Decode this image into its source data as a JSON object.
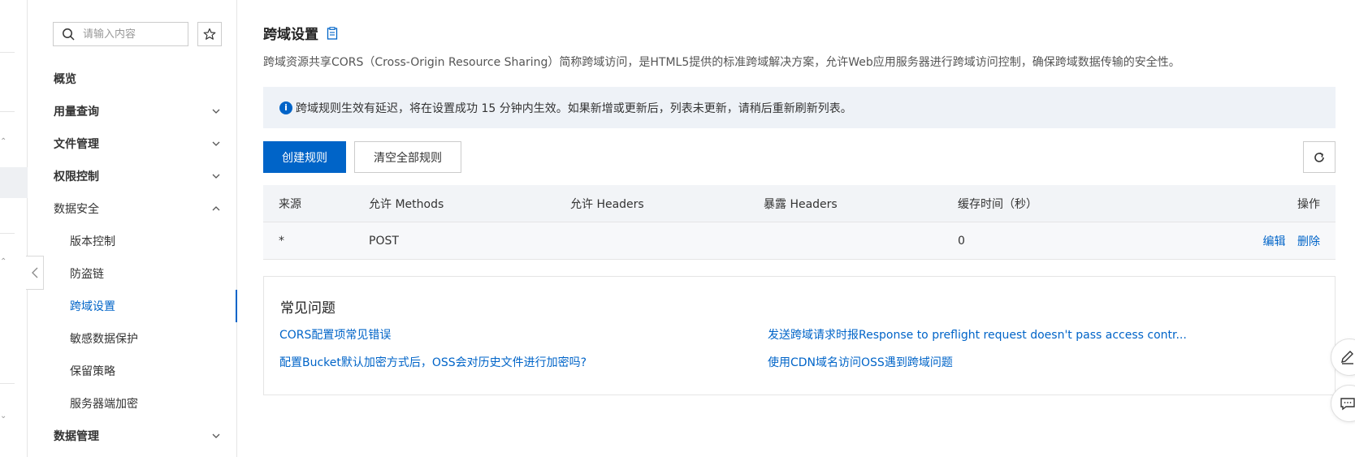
{
  "sidebar": {
    "search_placeholder": "请输入内容",
    "nav": [
      {
        "label": "概览"
      },
      {
        "label": "用量查询"
      },
      {
        "label": "文件管理"
      },
      {
        "label": "权限控制"
      },
      {
        "label": "数据安全"
      },
      {
        "label": "版本控制"
      },
      {
        "label": "防盗链"
      },
      {
        "label": "跨域设置"
      },
      {
        "label": "敏感数据保护"
      },
      {
        "label": "保留策略"
      },
      {
        "label": "服务器端加密"
      },
      {
        "label": "数据管理"
      }
    ]
  },
  "main": {
    "title": "跨域设置",
    "description": "跨域资源共享CORS（Cross-Origin Resource Sharing）简称跨域访问，是HTML5提供的标准跨域解决方案，允许Web应用服务器进行跨域访问控制，确保跨域数据传输的安全性。",
    "notice": "跨域规则生效有延迟，将在设置成功 15 分钟内生效。如果新增或更新后，列表未更新，请稍后重新刷新列表。",
    "create_button": "创建规则",
    "clear_button": "清空全部规则",
    "table": {
      "headers": [
        "来源",
        "允许 Methods",
        "允许 Headers",
        "暴露 Headers",
        "缓存时间（秒）",
        "操作"
      ],
      "rows": [
        {
          "origin": "*",
          "methods": "POST",
          "allow_headers": "",
          "expose_headers": "",
          "cache": "0",
          "edit": "编辑",
          "delete": "删除"
        }
      ]
    },
    "faq": {
      "title": "常见问题",
      "links": [
        "CORS配置项常见错误",
        "发送跨域请求时报Response to preflight request doesn't pass access contr...",
        "配置Bucket默认加密方式后，OSS会对历史文件进行加密吗?",
        "使用CDN域名访问OSS遇到跨域问题"
      ]
    }
  },
  "colors": {
    "accent": "#0064c8",
    "notice_bg": "#eef2f7",
    "table_header_bg": "#f2f4f7"
  }
}
